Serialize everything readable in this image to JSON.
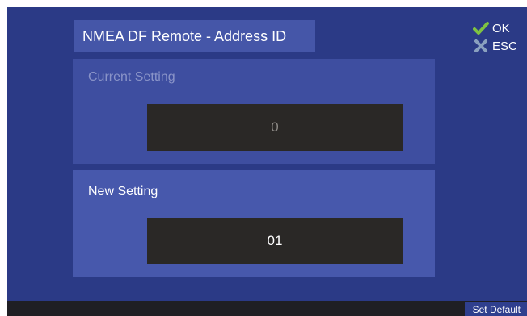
{
  "title": "NMEA DF Remote - Address ID",
  "actions": {
    "ok_label": "OK",
    "esc_label": "ESC"
  },
  "current": {
    "label": "Current Setting",
    "value": "0"
  },
  "new": {
    "label": "New Setting",
    "value": "01"
  },
  "bottom": {
    "set_default_label": "Set Default"
  },
  "colors": {
    "background": "#2b3a86",
    "ok_check": "#7fc241",
    "esc_x": "#8aa0bf"
  }
}
